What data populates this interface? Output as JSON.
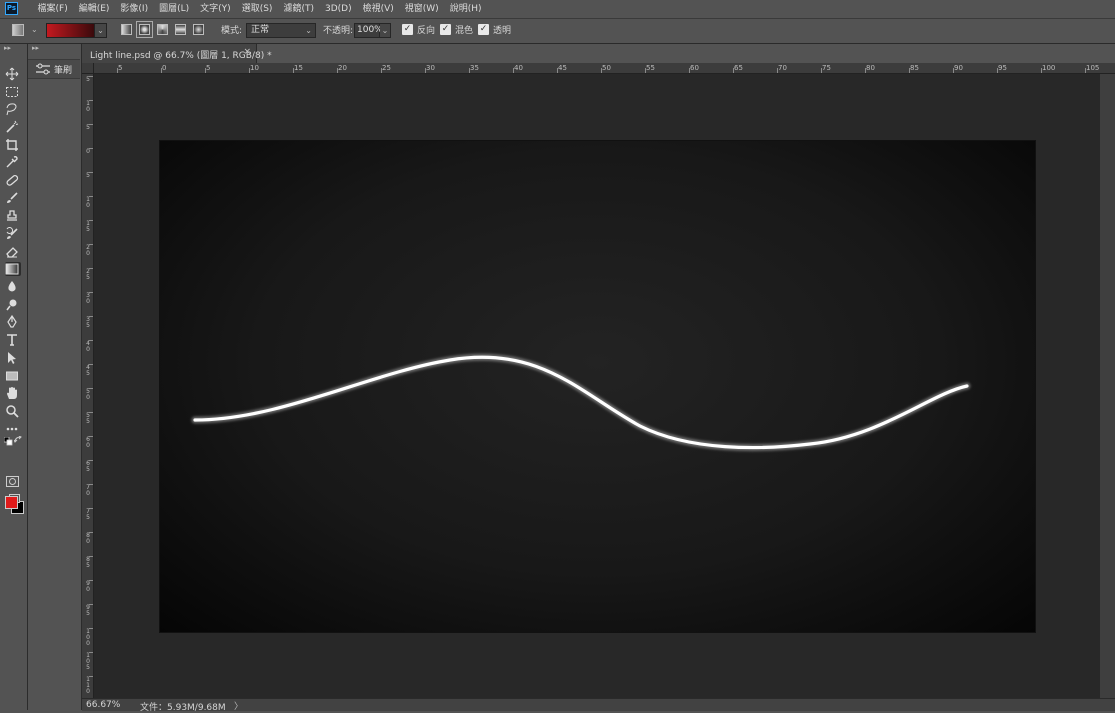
{
  "app": {
    "logo": "Ps"
  },
  "menu": {
    "items": [
      {
        "id": "file",
        "label": "檔案(F)"
      },
      {
        "id": "edit",
        "label": "編輯(E)"
      },
      {
        "id": "image",
        "label": "影像(I)"
      },
      {
        "id": "layer",
        "label": "圖層(L)"
      },
      {
        "id": "type",
        "label": "文字(Y)"
      },
      {
        "id": "select",
        "label": "選取(S)"
      },
      {
        "id": "filter",
        "label": "濾鏡(T)"
      },
      {
        "id": "3d",
        "label": "3D(D)"
      },
      {
        "id": "view",
        "label": "檢視(V)"
      },
      {
        "id": "window",
        "label": "視窗(W)"
      },
      {
        "id": "help",
        "label": "說明(H)"
      }
    ]
  },
  "options": {
    "gradient_start_color": "#c3191f",
    "gradient_end_color": "#3a0a0c",
    "mode_label": "模式:",
    "mode_value": "正常",
    "opacity_label": "不透明:",
    "opacity_value": "100%",
    "reverse_label": "反向",
    "dither_label": "混色",
    "transparency_label": "透明",
    "reverse_checked": true,
    "dither_checked": true,
    "transparency_checked": true,
    "active_gradient_type": "radial"
  },
  "tools": [
    {
      "id": "move",
      "icon": "move-icon"
    },
    {
      "id": "marquee",
      "icon": "rect-marquee-icon"
    },
    {
      "id": "lasso",
      "icon": "lasso-icon"
    },
    {
      "id": "magic-wand",
      "icon": "magic-wand-icon"
    },
    {
      "id": "crop",
      "icon": "crop-icon"
    },
    {
      "id": "eyedropper",
      "icon": "eyedropper-icon"
    },
    {
      "id": "healing",
      "icon": "bandage-icon"
    },
    {
      "id": "brush",
      "icon": "brush-icon"
    },
    {
      "id": "stamp",
      "icon": "stamp-icon"
    },
    {
      "id": "history-brush",
      "icon": "history-brush-icon"
    },
    {
      "id": "eraser",
      "icon": "eraser-icon"
    },
    {
      "id": "gradient",
      "icon": "gradient-icon",
      "active": true
    },
    {
      "id": "blur",
      "icon": "blur-drop-icon"
    },
    {
      "id": "dodge",
      "icon": "dodge-icon"
    },
    {
      "id": "pen",
      "icon": "pen-icon"
    },
    {
      "id": "type",
      "icon": "type-icon"
    },
    {
      "id": "path-select",
      "icon": "arrow-icon"
    },
    {
      "id": "shape",
      "icon": "rectangle-icon"
    },
    {
      "id": "hand",
      "icon": "hand-icon"
    },
    {
      "id": "zoom",
      "icon": "zoom-icon"
    },
    {
      "id": "more",
      "icon": "more-icon"
    }
  ],
  "colors": {
    "foreground": "#e01b1b",
    "background": "#000000"
  },
  "panel": {
    "brush_label": "筆刷"
  },
  "document": {
    "tab_title": "Light line.psd @ 66.7% (圖層 1, RGB/8) *",
    "close_glyph": "×"
  },
  "rulers": {
    "horizontal": [
      "5",
      "0",
      "5",
      "10",
      "15",
      "20",
      "25",
      "30",
      "35",
      "40",
      "45",
      "50",
      "55",
      "60",
      "65",
      "70",
      "75",
      "80",
      "85",
      "90",
      "95",
      "100",
      "105"
    ],
    "vertical": [
      "5",
      "10",
      "5",
      "0",
      "5",
      "10",
      "15",
      "20",
      "25",
      "30",
      "35",
      "40",
      "45",
      "50",
      "55",
      "60",
      "65",
      "70",
      "75",
      "80",
      "85",
      "90",
      "95",
      "100",
      "105",
      "110"
    ]
  },
  "status": {
    "zoom": "66.67%",
    "file_info": "文件：5.93M/9.68M",
    "arrow": "〉"
  }
}
